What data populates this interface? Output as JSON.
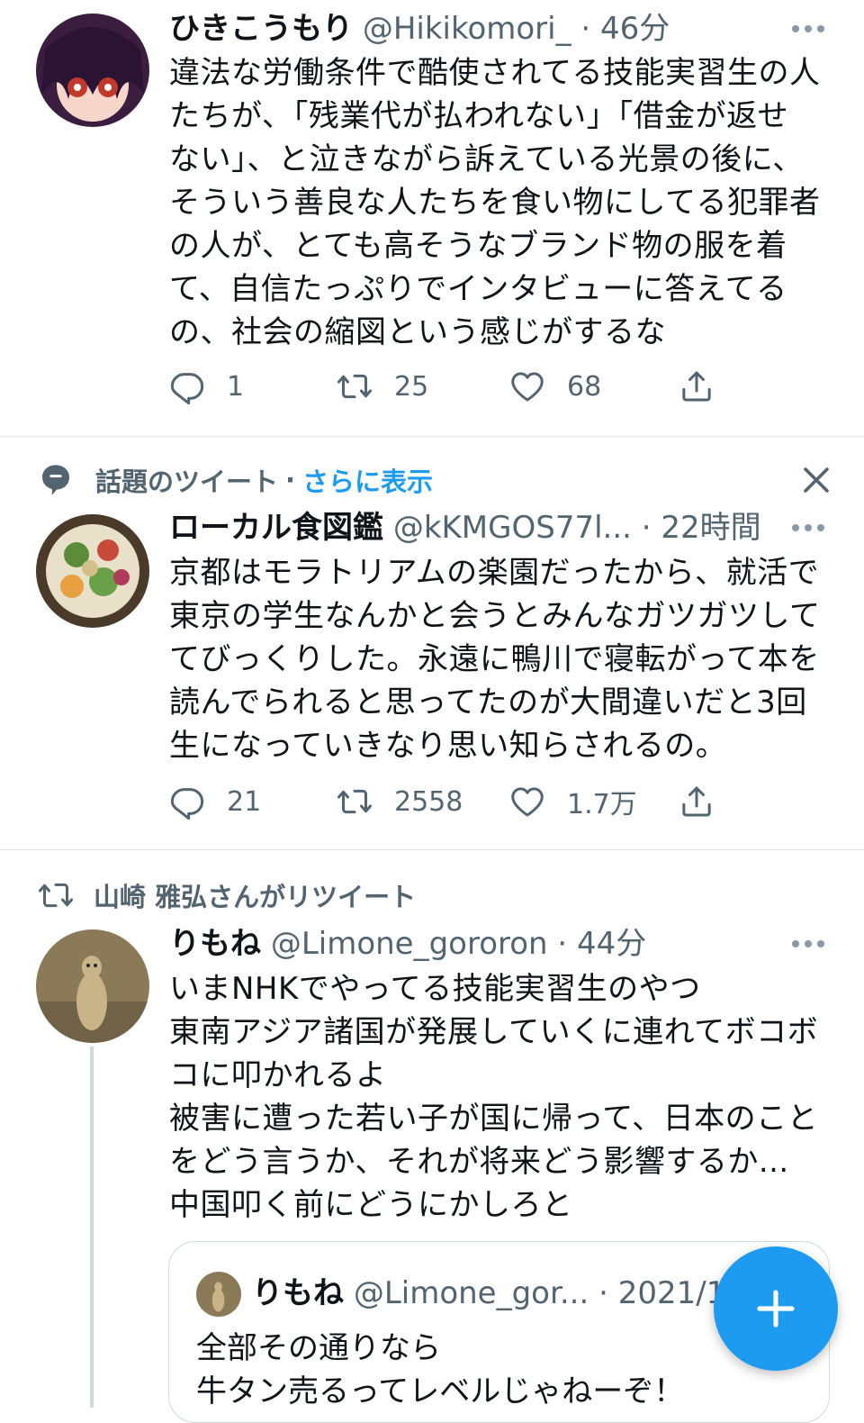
{
  "tweets": [
    {
      "name": "ひきこうもり",
      "handle": "@Hikikomori_",
      "dot": "·",
      "time": "46分",
      "lines": [
        "違法な労働条件で酷使されてる技能実習生の人",
        "たちが、「残業代が払われない」「借金が返せ",
        "ない」、と泣きながら訴えている光景の後に、",
        "そういう善良な人たちを食い物にしてる犯罪者",
        "の人が、とても高そうなブランド物の服を着",
        "て、自信たっぷりでインタビューに答えてる",
        "の、社会の縮図という感じがするな"
      ],
      "replies": "1",
      "retweets": "25",
      "likes": "68"
    },
    {
      "context_label": "話題のツイート",
      "context_dot": "·",
      "context_link": "さらに表示",
      "name": "ローカル食図鑑",
      "handle": "@kKMGOS77l...",
      "dot": "·",
      "time": "22時間",
      "lines": [
        "京都はモラトリアムの楽園だったから、就活で",
        "東京の学生なんかと会うとみんなガツガツして",
        "てびっくりした。永遠に鴨川で寝転がって本を",
        "読んでられると思ってたのが大間違いだと3回",
        "生になっていきなり思い知らされるの。"
      ],
      "replies": "21",
      "retweets": "2558",
      "likes": "1.7万"
    },
    {
      "context_label": "山崎 雅弘さんがリツイート",
      "name": "りもね",
      "handle": "@Limone_gororon",
      "dot": "·",
      "time": "44分",
      "lines": [
        "いまNHKでやってる技能実習生のやつ",
        "東南アジア諸国が発展していくに連れてボコボ",
        "コに叩かれるよ",
        "被害に遭った若い子が国に帰って、日本のこと",
        "をどう言うか、それが将来どう影響するか...",
        "中国叩く前にどうにかしろと"
      ],
      "quote": {
        "name": "りもね",
        "handle": "@Limone_gor...",
        "dot": "·",
        "time": "2021/11",
        "lines": [
          "全部その通りなら",
          "牛タン売るってレベルじゃねーぞ！"
        ]
      }
    }
  ],
  "colors": {
    "accent": "#1d9bf0",
    "muted": "#536471",
    "text": "#0f1419"
  },
  "icons": [
    "reply-icon",
    "retweet-icon",
    "like-icon",
    "share-icon",
    "more-icon",
    "close-icon",
    "topic-icon",
    "compose-icon"
  ]
}
